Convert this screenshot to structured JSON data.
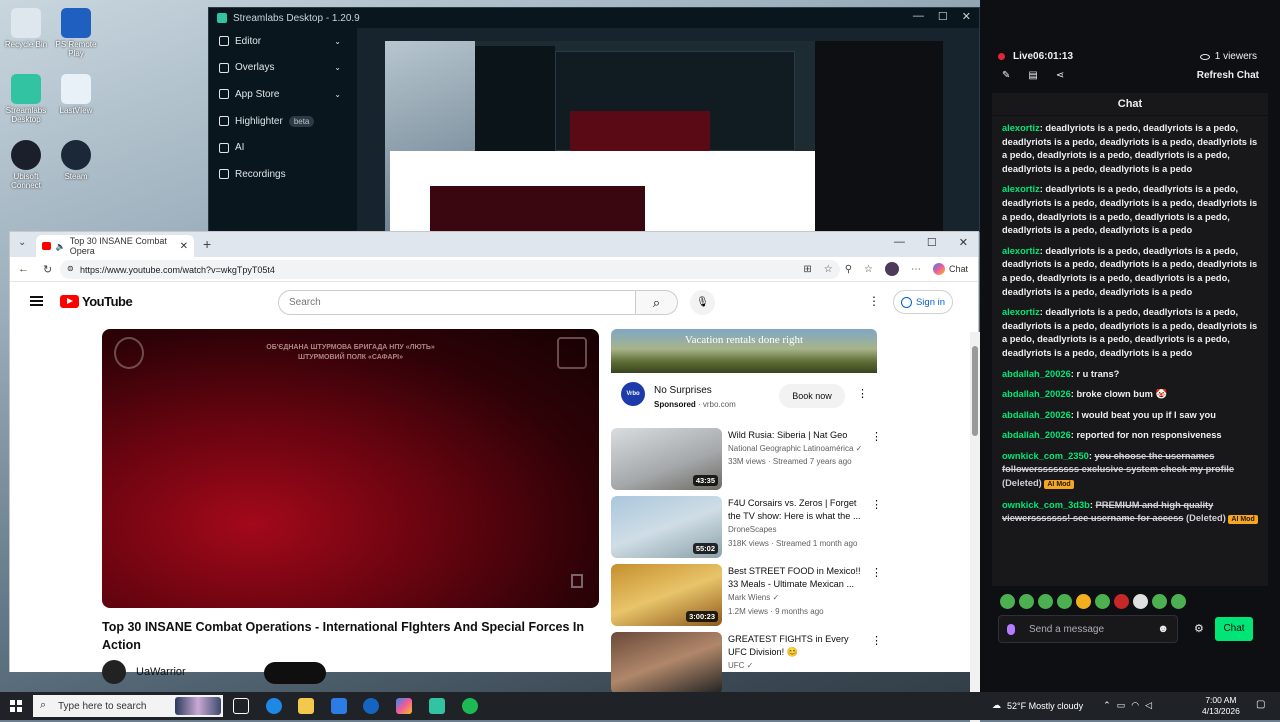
{
  "desktop": {
    "icons": [
      {
        "label": "Recycle Bin",
        "color": "#dfe7ee"
      },
      {
        "label": "PS Remote Play",
        "color": "#1f5fbf"
      },
      {
        "label": "Streamlabs Desktop",
        "color": "#31c3a2"
      },
      {
        "label": "LastVIew",
        "color": "#e8f0f8"
      },
      {
        "label": "Ubisoft Connect",
        "color": "#1b1f2b"
      },
      {
        "label": "Steam",
        "color": "#1b2838"
      }
    ]
  },
  "streamlabs": {
    "title": "Streamlabs Desktop - 1.20.9",
    "nav": [
      {
        "label": "Editor",
        "chevron": "⌄"
      },
      {
        "label": "Overlays",
        "chevron": "⌄"
      },
      {
        "label": "App Store",
        "chevron": "⌄"
      },
      {
        "label": "Highlighter",
        "badge": "beta"
      },
      {
        "label": "AI"
      },
      {
        "label": "Recordings"
      }
    ]
  },
  "chat_panel": {
    "live_label": "Live",
    "live_time": "06:01:13",
    "viewers": "1 viewers",
    "refresh_label": "Refresh Chat",
    "header": "Chat",
    "messages": [
      {
        "user": "alexortiz",
        "text": "deadlyriots is a pedo, deadlyriots is a pedo, deadlyriots is a pedo, deadlyriots is a pedo, deadlyriots is a pedo, deadlyriots is a pedo, deadlyriots is a pedo, deadlyriots is a pedo, deadlyriots is a pedo",
        "color": "#00e676"
      },
      {
        "user": "alexortiz",
        "text": "deadlyriots is a pedo, deadlyriots is a pedo, deadlyriots is a pedo, deadlyriots is a pedo, deadlyriots is a pedo, deadlyriots is a pedo, deadlyriots is a pedo, deadlyriots is a pedo, deadlyriots is a pedo",
        "color": "#00e676"
      },
      {
        "user": "alexortiz",
        "text": "deadlyriots is a pedo, deadlyriots is a pedo, deadlyriots is a pedo, deadlyriots is a pedo, deadlyriots is a pedo, deadlyriots is a pedo, deadlyriots is a pedo, deadlyriots is a pedo, deadlyriots is a pedo",
        "color": "#00e676"
      },
      {
        "user": "alexortiz",
        "text": "deadlyriots is a pedo, deadlyriots is a pedo, deadlyriots is a pedo, deadlyriots is a pedo, deadlyriots is a pedo, deadlyriots is a pedo, deadlyriots is a pedo, deadlyriots is a pedo, deadlyriots is a pedo",
        "color": "#00e676"
      },
      {
        "user": "abdallah_20026",
        "text": "r u trans?",
        "color": "#00e676"
      },
      {
        "user": "abdallah_20026",
        "text": "broke clown bum 🤡",
        "color": "#00e676"
      },
      {
        "user": "abdallah_20026",
        "text": "I would beat you up if I saw you",
        "color": "#00e676"
      },
      {
        "user": "abdallah_20026",
        "text": "reported for non responsiveness",
        "color": "#00e676"
      }
    ],
    "deleted_messages": [
      {
        "user": "ownkick_com_2350",
        "text": "you choose the usernames followerssssssss exclusive system check my profile",
        "tag": "(Deleted)",
        "badge": "AI Mod"
      },
      {
        "user": "ownkick_com_3d3b",
        "text": "PREMIUM and high quality viewersssssss! see username for access",
        "tag": "(Deleted)",
        "badge": "AI Mod"
      }
    ],
    "input_placeholder": "Send a message",
    "send_label": "Chat"
  },
  "browser": {
    "tab_title": "Top 30 INSANE Combat Opera",
    "url": "https://www.youtube.com/watch?v=wkgTpyT05t4",
    "copilot_label": "Chat"
  },
  "youtube": {
    "logo": "YouTube",
    "search_placeholder": "Search",
    "signin_label": "Sign in",
    "video_overlay_text": "ОБ'ЄДНАНА ШТУРМОВА БРИГАДА НПУ «ЛЮТЬ»\nШТУРМОВИЙ ПОЛК «САФАРІ»",
    "video_title": "Top 30 INSANE Combat Operations - International FIghters And Special Forces In Action",
    "channel": "UaWarrior",
    "ad": {
      "banner_text": "Vacation rentals done right",
      "title": "No Surprises",
      "sponsored": "Sponsored",
      "domain": "vrbo.com",
      "logo_text": "Vrbo",
      "button": "Book now"
    },
    "recommendations": [
      {
        "title": "Wild Rusia: Siberia | Nat Geo",
        "channel": "National Geographic Latinoamérica ✓",
        "meta": "33M views · Streamed 7 years ago",
        "duration": "43:35",
        "thumb": "linear-gradient(160deg,#d9dde0,#a4a8aa 60%,#6e6a62)"
      },
      {
        "title": "F4U Corsairs vs. Zeros | Forget the TV show: Here is what the ...",
        "channel": "DroneScapes",
        "meta": "318K views · Streamed 1 month ago",
        "duration": "55:02",
        "thumb": "linear-gradient(160deg,#a9c7dc,#cfdde6 50%,#8aa0a8)"
      },
      {
        "title": "Best STREET FOOD in Mexico!! 33 Meals - Ultimate Mexican ...",
        "channel": "Mark Wiens ✓",
        "meta": "1.2M views · 9 months ago",
        "duration": "3:00:23",
        "thumb": "linear-gradient(160deg,#c58f2d,#e9c46a 50%,#8c5a1c)"
      },
      {
        "title": "GREATEST FIGHTS in Every UFC Division! 😊",
        "channel": "UFC ✓",
        "meta": "",
        "duration": "",
        "thumb": "linear-gradient(160deg,#6b4a3a,#b0876a 50%,#222)"
      }
    ]
  },
  "taskbar": {
    "search_placeholder": "Type here to search",
    "weather": "52°F  Mostly cloudy",
    "time": "7:00 AM",
    "date": "4/13/2026"
  }
}
